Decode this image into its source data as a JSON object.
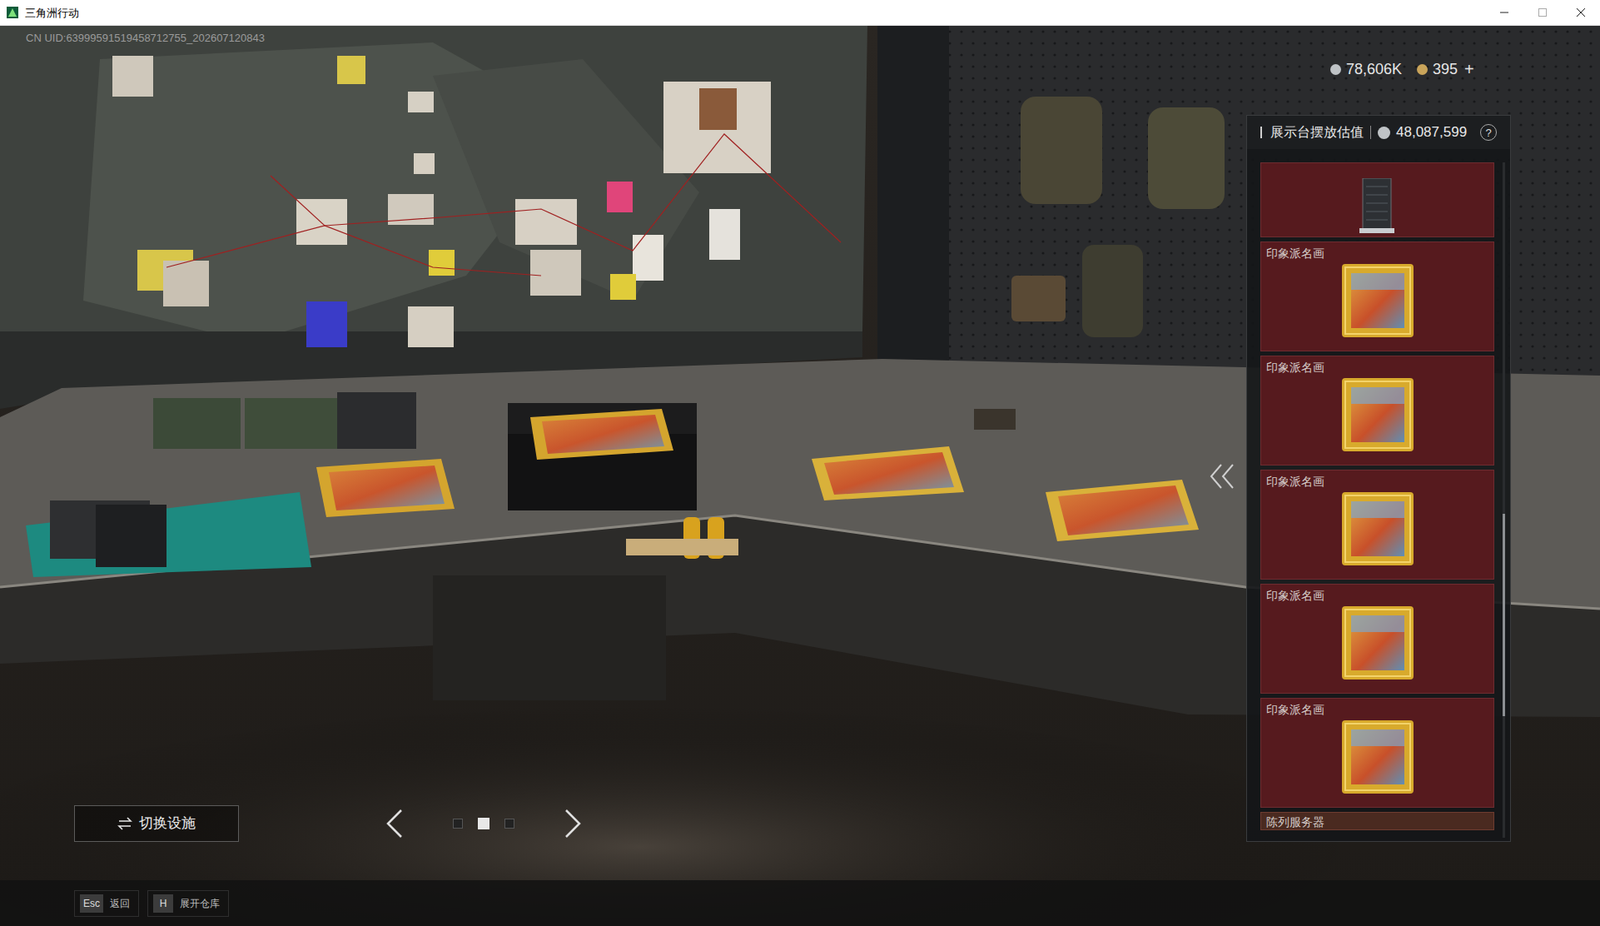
{
  "window": {
    "title": "三角洲行动"
  },
  "uid": "CN UID:63999591519458712755_202607120843",
  "currencies": [
    {
      "kind": "silver",
      "amount": "78,606K"
    },
    {
      "kind": "gold",
      "amount": "395"
    }
  ],
  "add_currency": "+",
  "display_panel": {
    "title": "展示台摆放估值",
    "value": "48,087,599",
    "help": "?",
    "items": [
      {
        "kind": "server"
      },
      {
        "kind": "painting",
        "name": "印象派名画"
      },
      {
        "kind": "painting",
        "name": "印象派名画"
      },
      {
        "kind": "painting",
        "name": "印象派名画"
      },
      {
        "kind": "painting",
        "name": "印象派名画"
      },
      {
        "kind": "painting",
        "name": "印象派名画"
      },
      {
        "kind": "label",
        "name": "陈列服务器"
      }
    ],
    "scrollbar": {
      "offset": 0.52,
      "size": 0.3
    }
  },
  "switch_button": {
    "label": "切换设施"
  },
  "pager": {
    "pages": [
      {
        "selected": false
      },
      {
        "selected": true
      },
      {
        "selected": false
      }
    ]
  },
  "hotkeys": [
    {
      "key": "Esc",
      "label": "返回"
    },
    {
      "key": "H",
      "label": "展开仓库"
    }
  ]
}
